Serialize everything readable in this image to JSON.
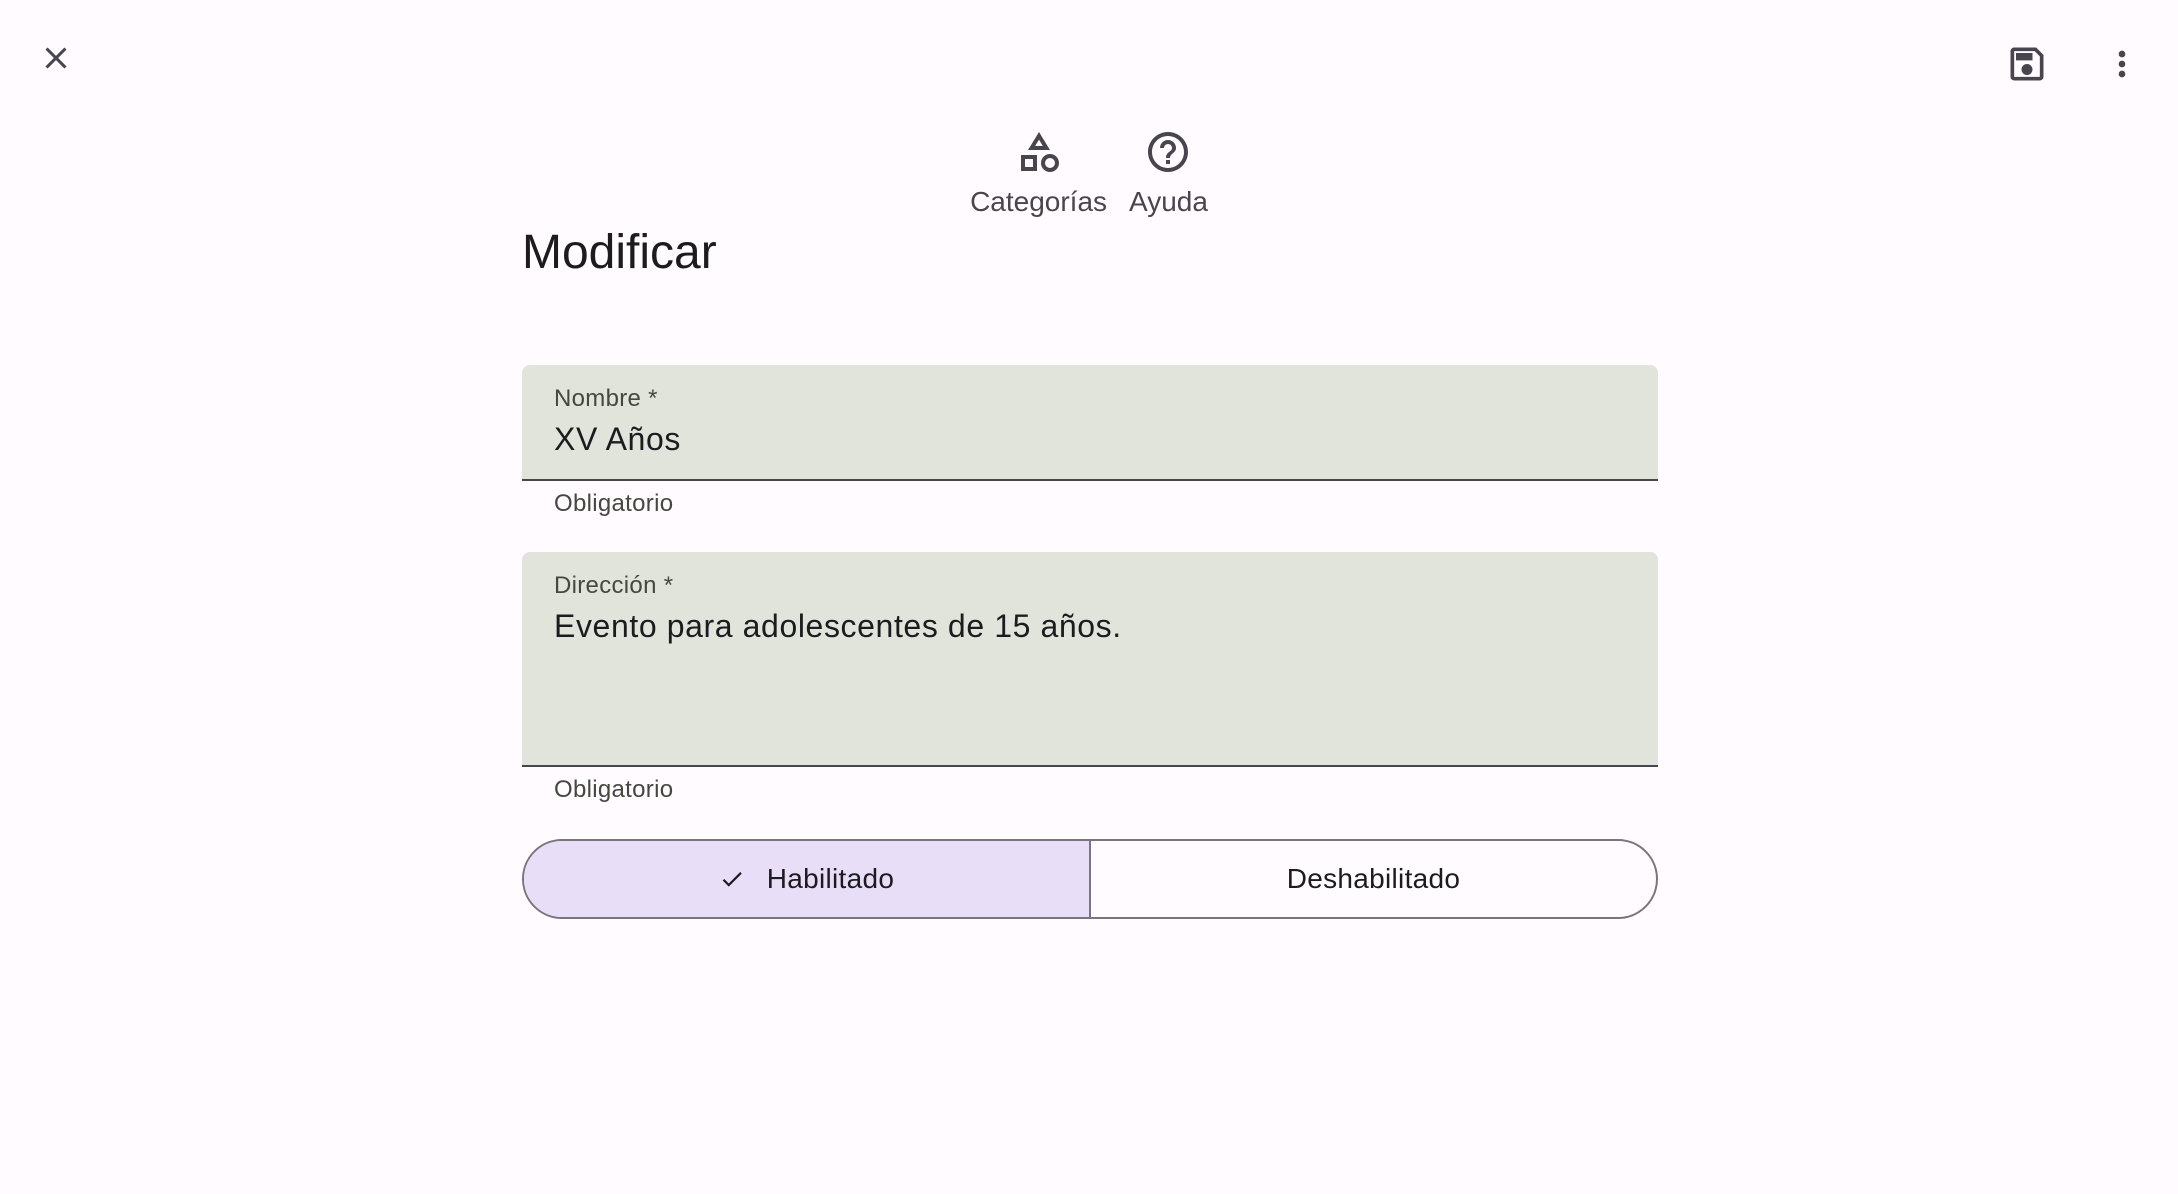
{
  "toolbar": {
    "close_icon": "close-icon",
    "save_icon": "save-icon",
    "more_icon": "more-vert-icon"
  },
  "top_actions": [
    {
      "label": "Categorías",
      "icon": "category-icon"
    },
    {
      "label": "Ayuda",
      "icon": "help-icon"
    }
  ],
  "page": {
    "title": "Modificar"
  },
  "form": {
    "nombre": {
      "label": "Nombre *",
      "value": "XV Años",
      "helper": "Obligatorio"
    },
    "direccion": {
      "label": "Dirección *",
      "value": "Evento para adolescentes de 15 años.",
      "helper": "Obligatorio"
    },
    "status": {
      "options": [
        "Habilitado",
        "Deshabilitado"
      ],
      "selected": "Habilitado"
    }
  },
  "colors": {
    "background": "#fffbfe",
    "field_fill": "#e1e4da",
    "selected_segment": "#e8def8",
    "icon": "#49454f"
  }
}
